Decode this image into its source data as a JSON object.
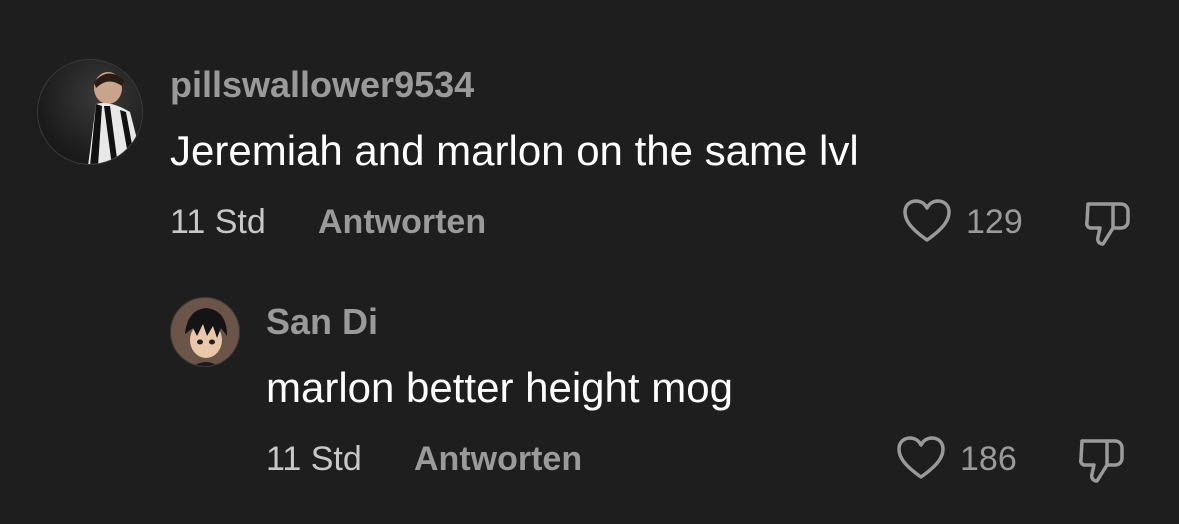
{
  "comments": [
    {
      "username": "pillswallower9534",
      "text": "Jeremiah and marlon on the same lvl",
      "time": "11 Std",
      "reply_label": "Antworten",
      "likes": "129",
      "avatar_icon": "user-avatar-icon"
    },
    {
      "username": "San Di",
      "text": "marlon better height mog",
      "time": "11 Std",
      "reply_label": "Antworten",
      "likes": "186",
      "avatar_icon": "user-avatar-icon"
    }
  ],
  "colors": {
    "background": "#1e1e1e",
    "username": "#9a9a9a",
    "text": "#ffffff",
    "meta": "#9a9a9a"
  }
}
